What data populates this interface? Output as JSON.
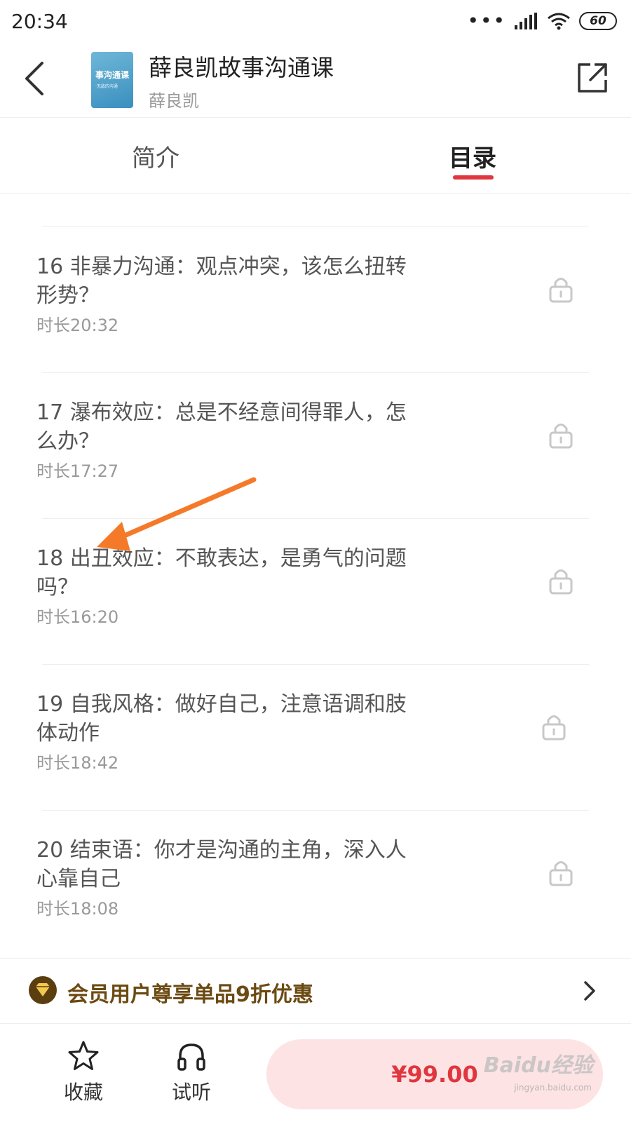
{
  "status_bar": {
    "time": "20:34",
    "battery": "60",
    "icons": [
      "dots-icon",
      "signal-icon",
      "wifi-icon",
      "battery-icon"
    ]
  },
  "header": {
    "title": "薛良凯故事沟通课",
    "author": "薛良凯",
    "cover_title": "事沟通课",
    "cover_subtitle": "·无敌的沟通",
    "back_icon": "back-arrow-icon",
    "share_icon": "share-icon"
  },
  "tabs": [
    {
      "label": "简介",
      "active": false
    },
    {
      "label": "目录",
      "active": true
    }
  ],
  "episodes": [
    {
      "title": "16 非暴力沟通：观点冲突，该怎么扭转形势？",
      "duration": "时长20:32",
      "locked": true
    },
    {
      "title": "17 瀑布效应：总是不经意间得罪人，怎么办？",
      "duration": "时长17:27",
      "locked": true
    },
    {
      "title": "18 出丑效应：不敢表达，是勇气的问题吗？",
      "duration": "时长16:20",
      "locked": true
    },
    {
      "title": "19 自我风格：做好自己，注意语调和肢体动作",
      "duration": "时长18:42",
      "locked": true
    },
    {
      "title": "20 结束语：你才是沟通的主角，深入人心靠自己",
      "duration": "时长18:08",
      "locked": true
    }
  ],
  "member_banner": {
    "text": "会员用户尊享单品9折优惠",
    "icon": "vip-diamond-icon"
  },
  "bottom_bar": {
    "favorite_label": "收藏",
    "listen_label": "试听",
    "price": "¥99.00",
    "accent_color": "#e0363e"
  },
  "watermark": {
    "text": "Baidu经验",
    "url": "jingyan.baidu.com"
  }
}
